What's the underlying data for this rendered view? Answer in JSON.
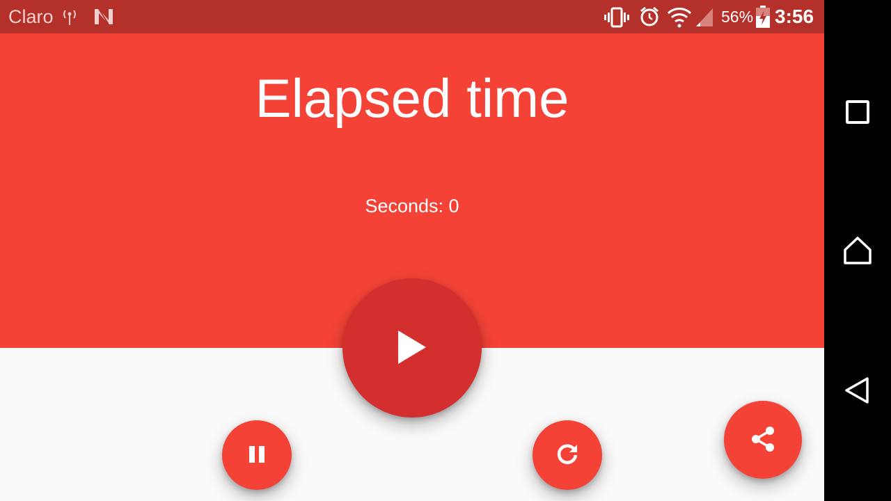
{
  "status_bar": {
    "carrier": "Claro",
    "battery_percent": "56%",
    "time": "3:56",
    "icons": [
      "hotspot-icon",
      "n-notification-icon",
      "vibrate-icon",
      "alarm-icon",
      "wifi-icon",
      "signal-icon",
      "battery-charging-icon"
    ]
  },
  "header": {
    "title": "Elapsed time",
    "seconds_text": "Seconds: 0"
  },
  "buttons": {
    "play_icon": "play-icon",
    "pause_icon": "pause-icon",
    "reset_icon": "refresh-icon",
    "share_icon": "share-icon"
  },
  "nav_bar": {
    "icons": [
      "recents-icon",
      "home-icon",
      "back-icon"
    ]
  },
  "colors": {
    "primary": "#f44336",
    "primary_dark": "#d32f2f",
    "status_bar": "#b3302b",
    "background": "#fafafa"
  }
}
